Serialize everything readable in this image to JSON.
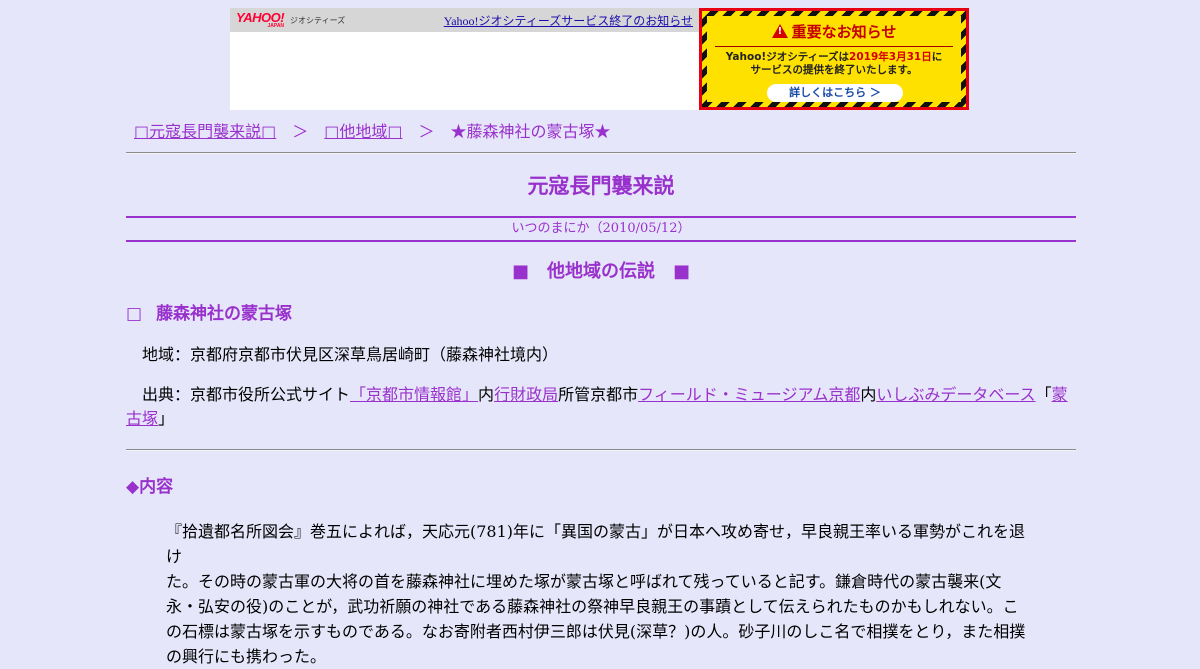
{
  "banner": {
    "logo_text": "YAHOO!",
    "logo_sub": "JAPAN",
    "service_name": "ジオシティーズ",
    "notice_link": "Yahoo!ジオシティーズサービス終了のお知らせ",
    "alert_title": "重要なお知らせ",
    "alert_line1_a": "Yahoo!ジオシティーズは",
    "alert_date": "2019年3月31日",
    "alert_line1_b": "に",
    "alert_line2": "サービスの提供を終了いたします。",
    "details_button": "詳しくはこちら ＞"
  },
  "breadcrumb": {
    "crumb1": "□元寇長門襲来説□",
    "sep": "＞",
    "crumb2": "□他地域□",
    "current": "★藤森神社の蒙古塚★"
  },
  "site_title": "元寇長門襲来説",
  "updated": "いつのまにか（2010/05/12）",
  "section_title": "■　他地域の伝説　■",
  "item": {
    "mark": "□",
    "title": "藤森神社の蒙古塚",
    "region_label": "地域：",
    "region_value": "京都府京都市伏見区深草鳥居崎町（藤森神社境内）",
    "source_label": "出典：",
    "source_text1": "京都市役所公式サイト",
    "source_link1": "「京都市情報館」",
    "source_text2": "内",
    "source_link2": "行財政局",
    "source_text3": "所管京都市",
    "source_link3": "フィールド・ミュージアム京都",
    "source_text4": "内",
    "source_link4": "いしぶみデータベース",
    "source_text5": "「",
    "source_link5": "蒙古塚",
    "source_text6": "」"
  },
  "content": {
    "heading": "◆内容",
    "line1": "『拾遺都名所図会』巻五によれば，天応元(781)年に「異国の蒙古」が日本へ攻め寄せ，早良親王率いる軍勢がこれを退け",
    "line2": "た。その時の蒙古軍の大将の首を藤森神社に埋めた塚が蒙古塚と呼ばれて残っていると記す。鎌倉時代の蒙古襲来(文",
    "line3": "永・弘安の役)のことが，武功祈願の神社である藤森神社の祭神早良親王の事蹟として伝えられたものかもしれない。こ",
    "line4": "の石標は蒙古塚を示すものである。なお寄附者西村伊三郎は伏見(深草？)の人。砂子川のしこ名で相撲をとり，また相撲",
    "line5": "の興行にも携わった。"
  }
}
